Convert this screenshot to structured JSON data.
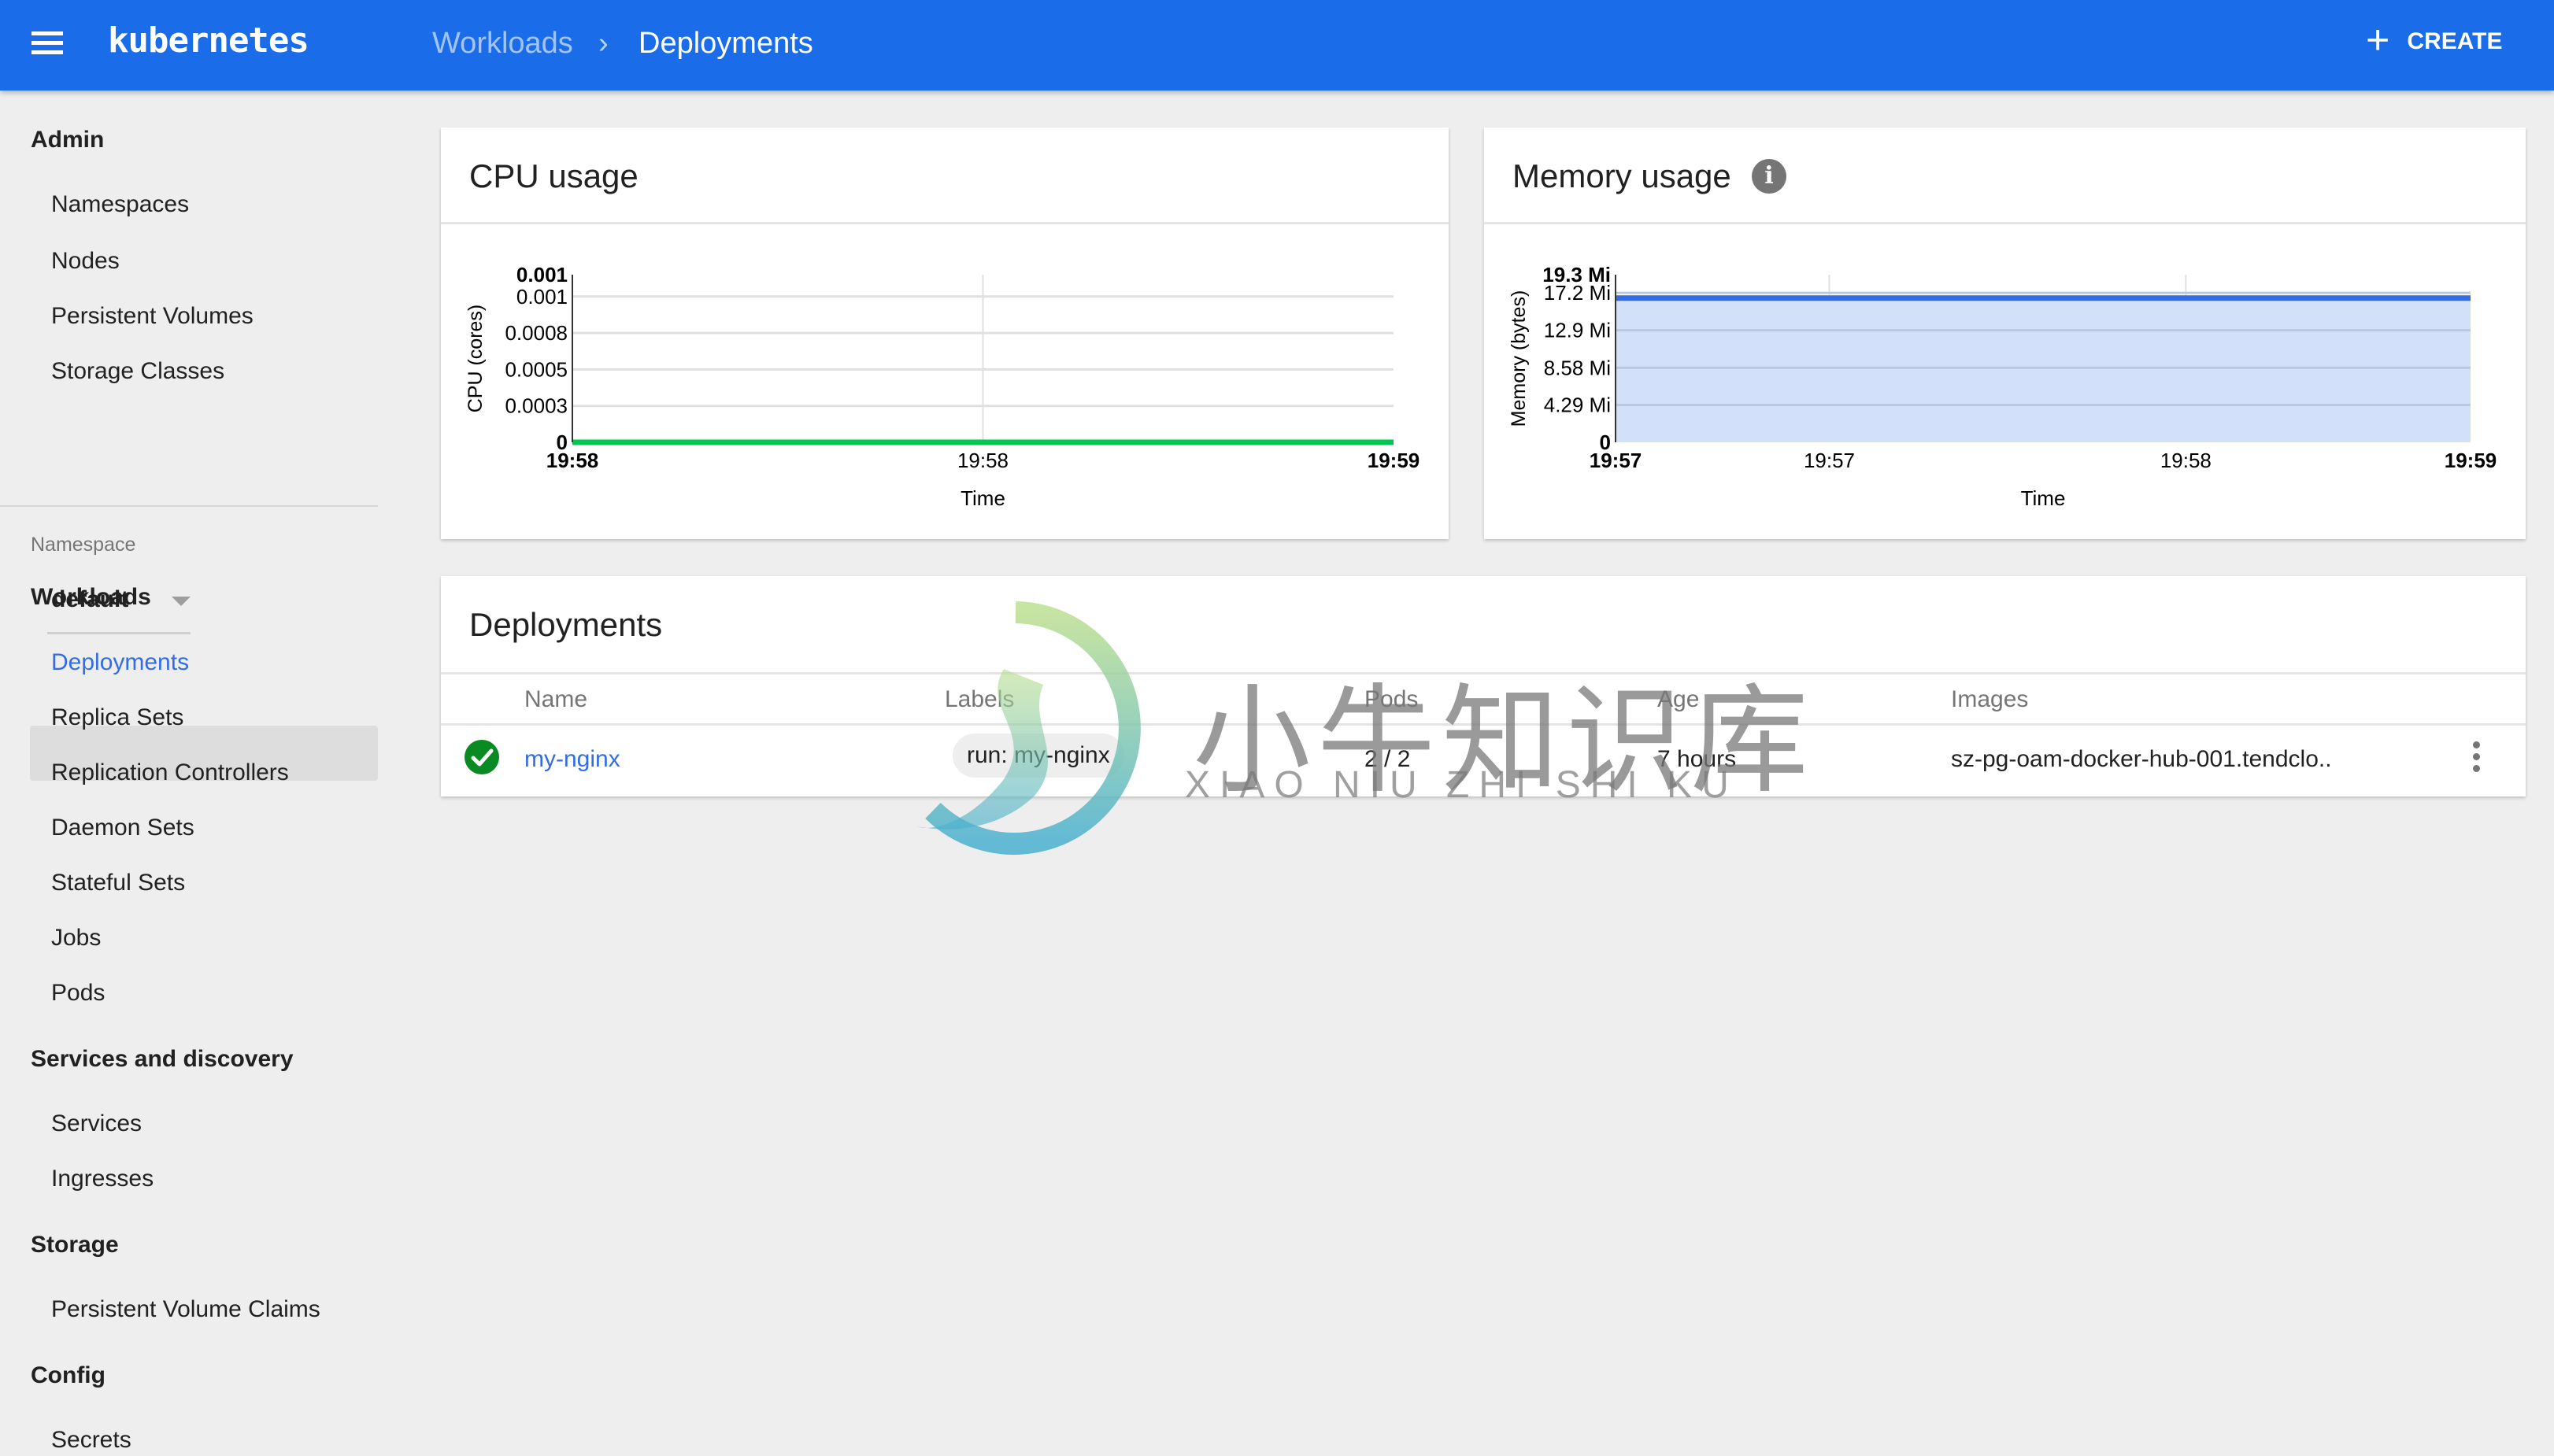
{
  "header": {
    "app_title": "kubernetes",
    "breadcrumb": {
      "parent": "Workloads",
      "separator": "›",
      "current": "Deployments"
    },
    "create_label": "CREATE",
    "icons": {
      "menu": "menu-icon",
      "create": "plus-icon"
    },
    "color": "#1a6ce8"
  },
  "sidebar": {
    "sections": [
      {
        "title": "Admin",
        "items": [
          "Namespaces",
          "Nodes",
          "Persistent Volumes",
          "Storage Classes"
        ]
      },
      {
        "title": "Workloads",
        "items": [
          "Deployments",
          "Replica Sets",
          "Replication Controllers",
          "Daemon Sets",
          "Stateful Sets",
          "Jobs",
          "Pods"
        ]
      },
      {
        "title": "Services and discovery",
        "items": [
          "Services",
          "Ingresses"
        ]
      },
      {
        "title": "Storage",
        "items": [
          "Persistent Volume Claims"
        ]
      },
      {
        "title": "Config",
        "items": [
          "Secrets"
        ]
      }
    ],
    "namespace": {
      "label": "Namespace",
      "selected": "default"
    },
    "active_item": "Deployments",
    "active_color": "#326de6"
  },
  "cpu_card": {
    "title": "CPU usage"
  },
  "memory_card": {
    "title": "Memory usage",
    "info_icon": "i"
  },
  "chart_data": [
    {
      "type": "line",
      "title": "CPU usage",
      "xlabel": "Time",
      "ylabel": "CPU (cores)",
      "x_ticks": [
        "19:58",
        "19:58",
        "19:59"
      ],
      "y_ticks": [
        "0",
        "0.0003",
        "0.0005",
        "0.0008",
        "0.001",
        "0.001"
      ],
      "y_tick_values": [
        0,
        0.00025,
        0.0005,
        0.00075,
        0.001,
        0.00115
      ],
      "ylim": [
        0,
        0.00115
      ],
      "series": [
        {
          "name": "CPU usage",
          "color": "#00c752",
          "x": [
            0,
            1
          ],
          "values": [
            0,
            0
          ]
        }
      ],
      "grid": true
    },
    {
      "type": "area",
      "title": "Memory usage",
      "xlabel": "Time",
      "ylabel": "Memory (bytes)",
      "x_ticks": [
        "19:57",
        "19:57",
        "19:58",
        "19:59"
      ],
      "x_tick_positions": [
        0,
        0.25,
        0.667,
        1
      ],
      "y_ticks": [
        "0",
        "4.29 Mi",
        "8.58 Mi",
        "12.9 Mi",
        "17.2 Mi",
        "19.3 Mi"
      ],
      "y_tick_values": [
        0,
        4.29,
        8.58,
        12.9,
        17.2,
        19.3
      ],
      "ylim": [
        0,
        19.3
      ],
      "series": [
        {
          "name": "Memory usage",
          "color": "#326de6",
          "fill": "#d3e0f9",
          "x": [
            0,
            1
          ],
          "values": [
            16.6,
            16.6
          ]
        }
      ],
      "grid": true
    }
  ],
  "deployments": {
    "title": "Deployments",
    "columns": [
      "Name",
      "Labels",
      "Pods",
      "Age",
      "Images"
    ],
    "rows": [
      {
        "status": "running",
        "status_icon": "check-circle-icon",
        "name": "my-nginx",
        "labels": "run: my-nginx",
        "pods": "2 / 2",
        "age": "7 hours",
        "images": "sz-pg-oam-docker-hub-001.tendclo..",
        "menu_icon": "more-vert-icon"
      }
    ]
  },
  "watermark": {
    "cn": "小牛知识库",
    "en": "XIAO NIU ZHI SHI KU"
  }
}
